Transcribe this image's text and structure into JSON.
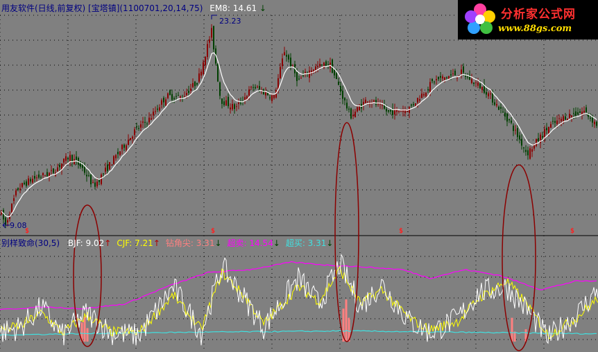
{
  "main_header": {
    "title": "用友软件(日线,前复权)",
    "indicator": "[宝塔镇](1100701,20,14,75)",
    "ema_label": "EM8:",
    "ema_value": "14.61",
    "ema_arrow": "↓"
  },
  "price_annotations": {
    "high_label": "23.23",
    "low_label": "9.08"
  },
  "sub_header": {
    "name": "别样致命(30,5)",
    "items": [
      {
        "label": "BJF:",
        "value": "9.02",
        "arrow": "↑",
        "color": "#ffffff"
      },
      {
        "label": "CJF:",
        "value": "7.21",
        "arrow": "↑",
        "color": "#ffff00"
      },
      {
        "label": "钻角尖:",
        "value": "3.31",
        "arrow": "↓",
        "color": "#ff8080"
      },
      {
        "label": "超卖:",
        "value": "14.54",
        "arrow": "↓",
        "color": "#ff00ff"
      },
      {
        "label": "超买:",
        "value": "3.31",
        "arrow": "↓",
        "color": "#40e0e0"
      }
    ]
  },
  "logo": {
    "title": "分析家公式网",
    "url": "www.88gs.com"
  },
  "colors": {
    "background": "#808080",
    "up_candle": "#8b0000",
    "down_candle": "#004000",
    "ema_line": "#ffffff",
    "bjf_line": "#ffffff",
    "cjf_line": "#ffff00",
    "oversell_line": "#ff00ff",
    "overbuy_line": "#40e0e0",
    "bar": "#ff8080",
    "ellipse": "#8b0000",
    "grid": "#000000"
  },
  "chart_data": [
    {
      "type": "candlestick",
      "title": "用友软件(日线,前复权)",
      "ylim": [
        8.5,
        24.5
      ],
      "price_anchors": [
        {
          "x": 0,
          "y": 10.1
        },
        {
          "x": 8,
          "y": 9.08
        },
        {
          "x": 25,
          "y": 11.7
        },
        {
          "x": 45,
          "y": 12.4
        },
        {
          "x": 75,
          "y": 12.9
        },
        {
          "x": 100,
          "y": 14.1
        },
        {
          "x": 118,
          "y": 13.3
        },
        {
          "x": 135,
          "y": 11.9
        },
        {
          "x": 160,
          "y": 13.6
        },
        {
          "x": 195,
          "y": 16.0
        },
        {
          "x": 215,
          "y": 16.8
        },
        {
          "x": 240,
          "y": 18.5
        },
        {
          "x": 262,
          "y": 18.4
        },
        {
          "x": 285,
          "y": 19.6
        },
        {
          "x": 305,
          "y": 23.23
        },
        {
          "x": 318,
          "y": 18.2
        },
        {
          "x": 340,
          "y": 17.6
        },
        {
          "x": 365,
          "y": 19.2
        },
        {
          "x": 395,
          "y": 18.4
        },
        {
          "x": 410,
          "y": 21.8
        },
        {
          "x": 430,
          "y": 19.6
        },
        {
          "x": 450,
          "y": 20.5
        },
        {
          "x": 475,
          "y": 20.9
        },
        {
          "x": 490,
          "y": 19.0
        },
        {
          "x": 505,
          "y": 17.0
        },
        {
          "x": 530,
          "y": 18.3
        },
        {
          "x": 560,
          "y": 17.3
        },
        {
          "x": 590,
          "y": 17.6
        },
        {
          "x": 625,
          "y": 19.6
        },
        {
          "x": 665,
          "y": 20.2
        },
        {
          "x": 700,
          "y": 18.9
        },
        {
          "x": 735,
          "y": 16.6
        },
        {
          "x": 760,
          "y": 14.3
        },
        {
          "x": 790,
          "y": 16.2
        },
        {
          "x": 815,
          "y": 17.0
        },
        {
          "x": 842,
          "y": 17.4
        },
        {
          "x": 862,
          "y": 16.3
        }
      ],
      "annotations": [
        {
          "label": "23.23",
          "x": 305,
          "y": 23.23
        },
        {
          "label": "9.08",
          "x": 8,
          "y": 9.08
        }
      ],
      "signals": [
        40,
        308,
        579,
        826
      ]
    },
    {
      "type": "line",
      "title": "别样致命(30,5)",
      "ylim": [
        0,
        18
      ],
      "series": [
        {
          "name": "BJF",
          "value": 9.02,
          "anchors": [
            {
              "x": 0,
              "y": 3.0
            },
            {
              "x": 30,
              "y": 4.0
            },
            {
              "x": 60,
              "y": 7.5
            },
            {
              "x": 90,
              "y": 2.5
            },
            {
              "x": 125,
              "y": 6.5
            },
            {
              "x": 160,
              "y": 3.0
            },
            {
              "x": 200,
              "y": 2.5
            },
            {
              "x": 250,
              "y": 11.0
            },
            {
              "x": 290,
              "y": 3.0
            },
            {
              "x": 320,
              "y": 14.5
            },
            {
              "x": 355,
              "y": 8.5
            },
            {
              "x": 380,
              "y": 4.0
            },
            {
              "x": 430,
              "y": 12.5
            },
            {
              "x": 460,
              "y": 8.0
            },
            {
              "x": 490,
              "y": 15.0
            },
            {
              "x": 520,
              "y": 7.5
            },
            {
              "x": 550,
              "y": 11.5
            },
            {
              "x": 590,
              "y": 5.0
            },
            {
              "x": 620,
              "y": 3.0
            },
            {
              "x": 660,
              "y": 5.5
            },
            {
              "x": 690,
              "y": 10.0
            },
            {
              "x": 730,
              "y": 11.0
            },
            {
              "x": 760,
              "y": 7.0
            },
            {
              "x": 790,
              "y": 2.0
            },
            {
              "x": 830,
              "y": 6.0
            },
            {
              "x": 862,
              "y": 10.5
            }
          ]
        },
        {
          "name": "CJF",
          "value": 7.21,
          "anchors": [
            {
              "x": 0,
              "y": 3.5
            },
            {
              "x": 30,
              "y": 4.2
            },
            {
              "x": 60,
              "y": 6.5
            },
            {
              "x": 90,
              "y": 3.0
            },
            {
              "x": 125,
              "y": 6.0
            },
            {
              "x": 160,
              "y": 3.2
            },
            {
              "x": 200,
              "y": 3.0
            },
            {
              "x": 250,
              "y": 9.5
            },
            {
              "x": 290,
              "y": 3.5
            },
            {
              "x": 320,
              "y": 13.5
            },
            {
              "x": 355,
              "y": 9.0
            },
            {
              "x": 380,
              "y": 4.5
            },
            {
              "x": 430,
              "y": 11.0
            },
            {
              "x": 460,
              "y": 8.5
            },
            {
              "x": 490,
              "y": 14.0
            },
            {
              "x": 520,
              "y": 8.0
            },
            {
              "x": 550,
              "y": 10.5
            },
            {
              "x": 590,
              "y": 5.5
            },
            {
              "x": 620,
              "y": 3.5
            },
            {
              "x": 660,
              "y": 5.0
            },
            {
              "x": 690,
              "y": 9.0
            },
            {
              "x": 730,
              "y": 12.0
            },
            {
              "x": 760,
              "y": 8.0
            },
            {
              "x": 790,
              "y": 2.5
            },
            {
              "x": 830,
              "y": 5.5
            },
            {
              "x": 862,
              "y": 9.0
            }
          ]
        },
        {
          "name": "超卖",
          "value": 14.54,
          "anchors": [
            {
              "x": 0,
              "y": 7.0
            },
            {
              "x": 60,
              "y": 7.5
            },
            {
              "x": 120,
              "y": 7.2
            },
            {
              "x": 180,
              "y": 8.0
            },
            {
              "x": 240,
              "y": 11.0
            },
            {
              "x": 300,
              "y": 13.5
            },
            {
              "x": 360,
              "y": 14.0
            },
            {
              "x": 420,
              "y": 15.3
            },
            {
              "x": 470,
              "y": 14.8
            },
            {
              "x": 520,
              "y": 14.5
            },
            {
              "x": 580,
              "y": 14.0
            },
            {
              "x": 620,
              "y": 12.5
            },
            {
              "x": 670,
              "y": 14.0
            },
            {
              "x": 720,
              "y": 13.0
            },
            {
              "x": 780,
              "y": 10.5
            },
            {
              "x": 830,
              "y": 12.0
            },
            {
              "x": 862,
              "y": 12.0
            }
          ]
        },
        {
          "name": "超买",
          "value": 3.31,
          "anchors": [
            {
              "x": 0,
              "y": 2.6
            },
            {
              "x": 200,
              "y": 3.0
            },
            {
              "x": 500,
              "y": 3.31
            },
            {
              "x": 862,
              "y": 2.8
            }
          ]
        }
      ],
      "bars": [
        {
          "x": 118,
          "y": 4.8
        },
        {
          "x": 122,
          "y": 5.8
        },
        {
          "x": 126,
          "y": 3.8
        },
        {
          "x": 495,
          "y": 7.2
        },
        {
          "x": 499,
          "y": 8.8
        },
        {
          "x": 503,
          "y": 5.6
        },
        {
          "x": 738,
          "y": 5.6
        },
        {
          "x": 742,
          "y": 3.2
        },
        {
          "x": 758,
          "y": 3.6
        }
      ]
    }
  ]
}
